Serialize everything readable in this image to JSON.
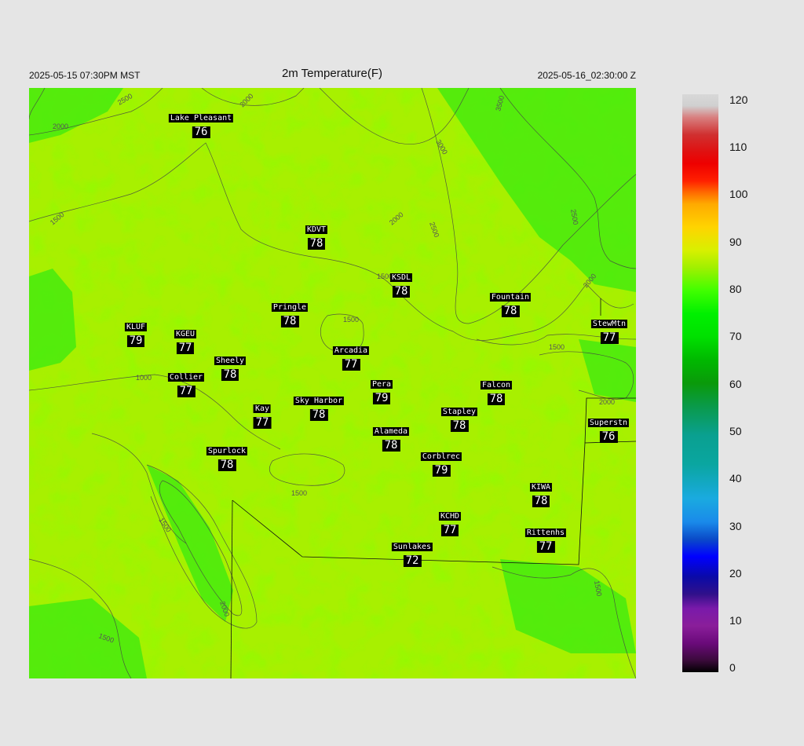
{
  "header": {
    "left": "2025-05-15 07:30PM MST",
    "title": "2m Temperature(F)",
    "right": "2025-05-16_02:30:00 Z"
  },
  "colorbar": {
    "labels": [
      "120",
      "110",
      "100",
      "90",
      "80",
      "70",
      "60",
      "50",
      "40",
      "30",
      "20",
      "10",
      "0"
    ]
  },
  "contour_labels": [
    "2500",
    "2000",
    "2000",
    "3500",
    "3000",
    "2500",
    "2500",
    "2000",
    "2000",
    "1500",
    "1500",
    "1500",
    "1500",
    "1000",
    "2000",
    "1500",
    "1500",
    "2000",
    "1500",
    "1500"
  ],
  "stations": [
    {
      "name": "Lake Pleasant",
      "value": "76"
    },
    {
      "name": "KDVT",
      "value": "78"
    },
    {
      "name": "KSDL",
      "value": "78"
    },
    {
      "name": "Fountain",
      "value": "78"
    },
    {
      "name": "StewMtn",
      "value": "77"
    },
    {
      "name": "Pringle",
      "value": "78"
    },
    {
      "name": "KLUF",
      "value": "79"
    },
    {
      "name": "KGEU",
      "value": "77"
    },
    {
      "name": "Arcadia",
      "value": "77"
    },
    {
      "name": "Sheely",
      "value": "78"
    },
    {
      "name": "Collier",
      "value": "77"
    },
    {
      "name": "Pera",
      "value": "79"
    },
    {
      "name": "Falcon",
      "value": "78"
    },
    {
      "name": "Kay",
      "value": "77"
    },
    {
      "name": "Sky Harbor",
      "value": "78"
    },
    {
      "name": "Stapley",
      "value": "78"
    },
    {
      "name": "Superstn",
      "value": "76"
    },
    {
      "name": "Alameda",
      "value": "78"
    },
    {
      "name": "Spurlock",
      "value": "78"
    },
    {
      "name": "Corblrec",
      "value": "79"
    },
    {
      "name": "KIWA",
      "value": "78"
    },
    {
      "name": "KCHD",
      "value": "77"
    },
    {
      "name": "Rittenhs",
      "value": "77"
    },
    {
      "name": "Sunlakes",
      "value": "72"
    }
  ]
}
